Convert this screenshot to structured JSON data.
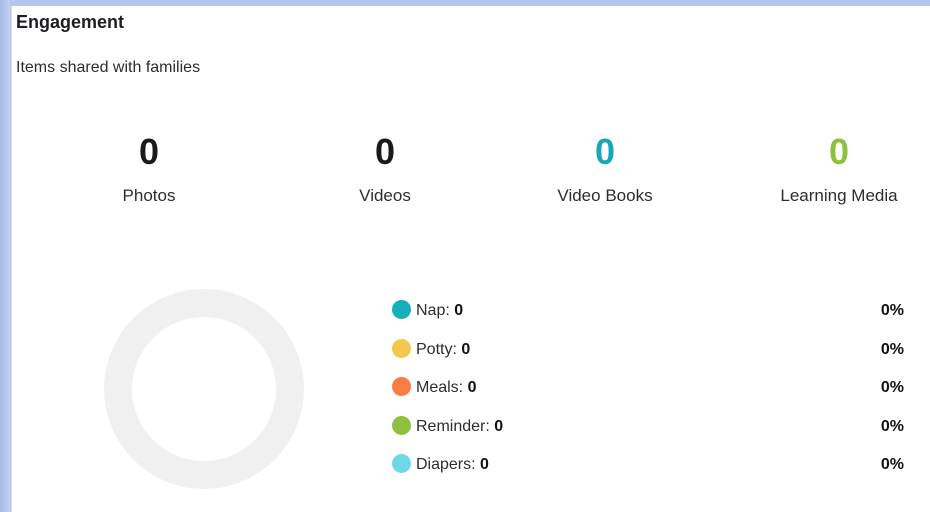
{
  "panel": {
    "title": "Engagement",
    "subtitle": "Items shared with families"
  },
  "stats": [
    {
      "value": "0",
      "label": "Photos",
      "color": "#1a1a1a"
    },
    {
      "value": "0",
      "label": "Videos",
      "color": "#1a1a1a"
    },
    {
      "value": "0",
      "label": "Video Books",
      "color": "#1aa7b4"
    },
    {
      "value": "0",
      "label": "Learning Media",
      "color": "#8dc03f"
    }
  ],
  "chart_data": {
    "type": "pie",
    "categories": [
      "Nap",
      "Potty",
      "Meals",
      "Reminder",
      "Diapers"
    ],
    "values": [
      0,
      0,
      0,
      0,
      0
    ],
    "percentages": [
      "0%",
      "0%",
      "0%",
      "0%",
      "0%"
    ],
    "colors": [
      "#14afba",
      "#f2c84b",
      "#fa7c45",
      "#8dc03f",
      "#6dd8e7"
    ],
    "empty_ring_color": "#f0f0f0"
  },
  "legend": [
    {
      "label": "Nap:",
      "count": "0",
      "percent": "0%",
      "color": "#14afba"
    },
    {
      "label": "Potty:",
      "count": "0",
      "percent": "0%",
      "color": "#f2c84b"
    },
    {
      "label": "Meals:",
      "count": "0",
      "percent": "0%",
      "color": "#fa7c45"
    },
    {
      "label": "Reminder:",
      "count": "0",
      "percent": "0%",
      "color": "#8dc03f"
    },
    {
      "label": "Diapers:",
      "count": "0",
      "percent": "0%",
      "color": "#6dd8e7"
    }
  ]
}
